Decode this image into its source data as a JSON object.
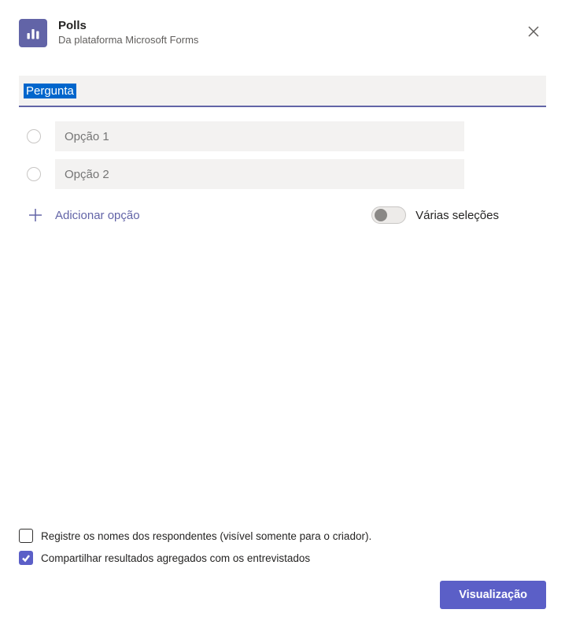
{
  "header": {
    "title": "Polls",
    "subtitle": "Da plataforma Microsoft Forms"
  },
  "question": {
    "placeholder": "Pergunta",
    "selected_text": "Pergunta"
  },
  "options": [
    {
      "placeholder": "Opção 1"
    },
    {
      "placeholder": "Opção 2"
    }
  ],
  "add_option_label": "Adicionar opção",
  "multi_select": {
    "label": "Várias seleções",
    "enabled": false
  },
  "checkboxes": {
    "record_names": {
      "label": "Registre os nomes dos respondentes (visível somente para o criador).",
      "checked": false
    },
    "share_results": {
      "label": "Compartilhar resultados agregados com os entrevistados",
      "checked": true
    }
  },
  "buttons": {
    "preview": "Visualização"
  },
  "colors": {
    "accent": "#5B5FC7",
    "icon_bg": "#6264A7"
  }
}
